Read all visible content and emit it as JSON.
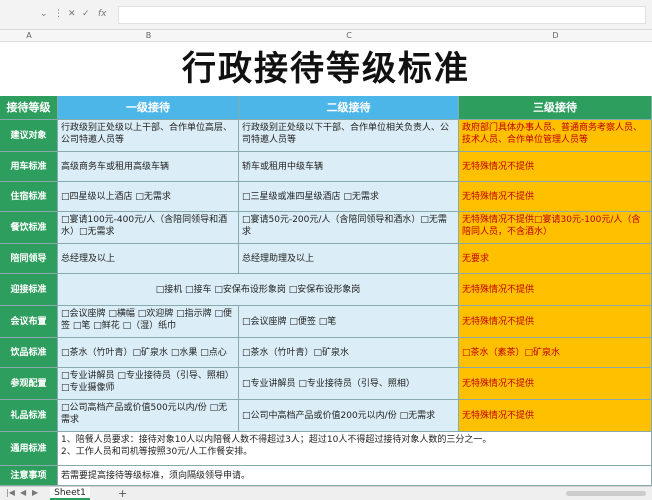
{
  "formula_bar": {
    "fx_label": "fx",
    "icons": [
      "chevron-down-icon",
      "more-icon",
      "cancel-icon",
      "confirm-icon",
      "fx-icon"
    ]
  },
  "column_headers": [
    "A",
    "B",
    "C",
    "D"
  ],
  "title": "行政接待等级标准",
  "table": {
    "header": [
      "接待等级",
      "一级接待",
      "二级接待",
      "三级接待"
    ],
    "rows": [
      {
        "label": "建议对象",
        "c1": "行政级别正处级以上干部、合作单位高层、公司特邀人员等",
        "c2": "行政级别正处级以下干部、合作单位相关负责人、公司特邀人员等",
        "c3": "政府部门具体办事人员、普通商务考察人员、技术人员、合作单位管理人员等"
      },
      {
        "label": "用车标准",
        "c1": "高级商务车或租用高级车辆",
        "c2": "轿车或租用中级车辆",
        "c3": "无特殊情况不提供"
      },
      {
        "label": "住宿标准",
        "c1": "□四星级以上酒店 □无需求",
        "c2": "□三星级或准四星级酒店 □无需求",
        "c3": "无特殊情况不提供"
      },
      {
        "label": "餐饮标准",
        "c1": "□宴请100元-400元/人（含陪同领导和酒水）□无需求",
        "c2": "□宴请50元-200元/人（含陪同领导和酒水）□无需求",
        "c3_pre": "无特殊情况不提供 □宴请",
        "c3_red": "30元-100元/人（含陪同人员，不含酒水）",
        "c3": "无特殊情况不提供□宴请30元-100元/人（含陪同人员，不含酒水）"
      },
      {
        "label": "陪同领导",
        "c1": "总经理及以上",
        "c2": "总经理助理及以上",
        "c3": "无要求"
      },
      {
        "label": "迎接标准",
        "c12": "□接机 □接车 □安保布设形象岗 □安保布设形象岗",
        "c3": "无特殊情况不提供"
      },
      {
        "label": "会议布置",
        "c1": "□会议座牌 □横幅 □欢迎牌 □指示牌 □便签 □笔 □鲜花 □（湿）纸巾",
        "c2": "□会议座牌 □便签 □笔",
        "c3": "无特殊情况不提供"
      },
      {
        "label": "饮品标准",
        "c1": "□茶水（竹叶青）□矿泉水 □水果 □点心",
        "c2": "□茶水（竹叶青）□矿泉水",
        "c3": "□茶水（素茶）□矿泉水"
      },
      {
        "label": "参观配置",
        "c1": "□专业讲解员 □专业接待员（引导、照相）□专业摄像师",
        "c2": "□专业讲解员 □专业接待员（引导、照相）",
        "c3": "无特殊情况不提供"
      },
      {
        "label": "礼品标准",
        "c1": "□公司高档产品或价值500元以内/份 □无需求",
        "c2": "□公司中高档产品或价值200元以内/份 □无需求",
        "c3": "无特殊情况不提供"
      },
      {
        "label": "通用标准",
        "full": [
          "1、陪餐人员要求：接待对象10人以内陪餐人数不得超过3人；超过10人不得超过接待对象人数的三分之一。",
          "2、工作人员和司机等按照30元/人工作餐安排。"
        ]
      },
      {
        "label": "注意事项",
        "full": [
          "若需要提高接待等级标准，须向隔级领导申请。"
        ]
      }
    ]
  },
  "sheet_tabs": {
    "active": "Sheet1",
    "add": "+"
  },
  "colors": {
    "green": "#2e9e5e",
    "blue_header": "#4db6e8",
    "light_blue": "#dbeef7",
    "orange": "#ffc000"
  }
}
